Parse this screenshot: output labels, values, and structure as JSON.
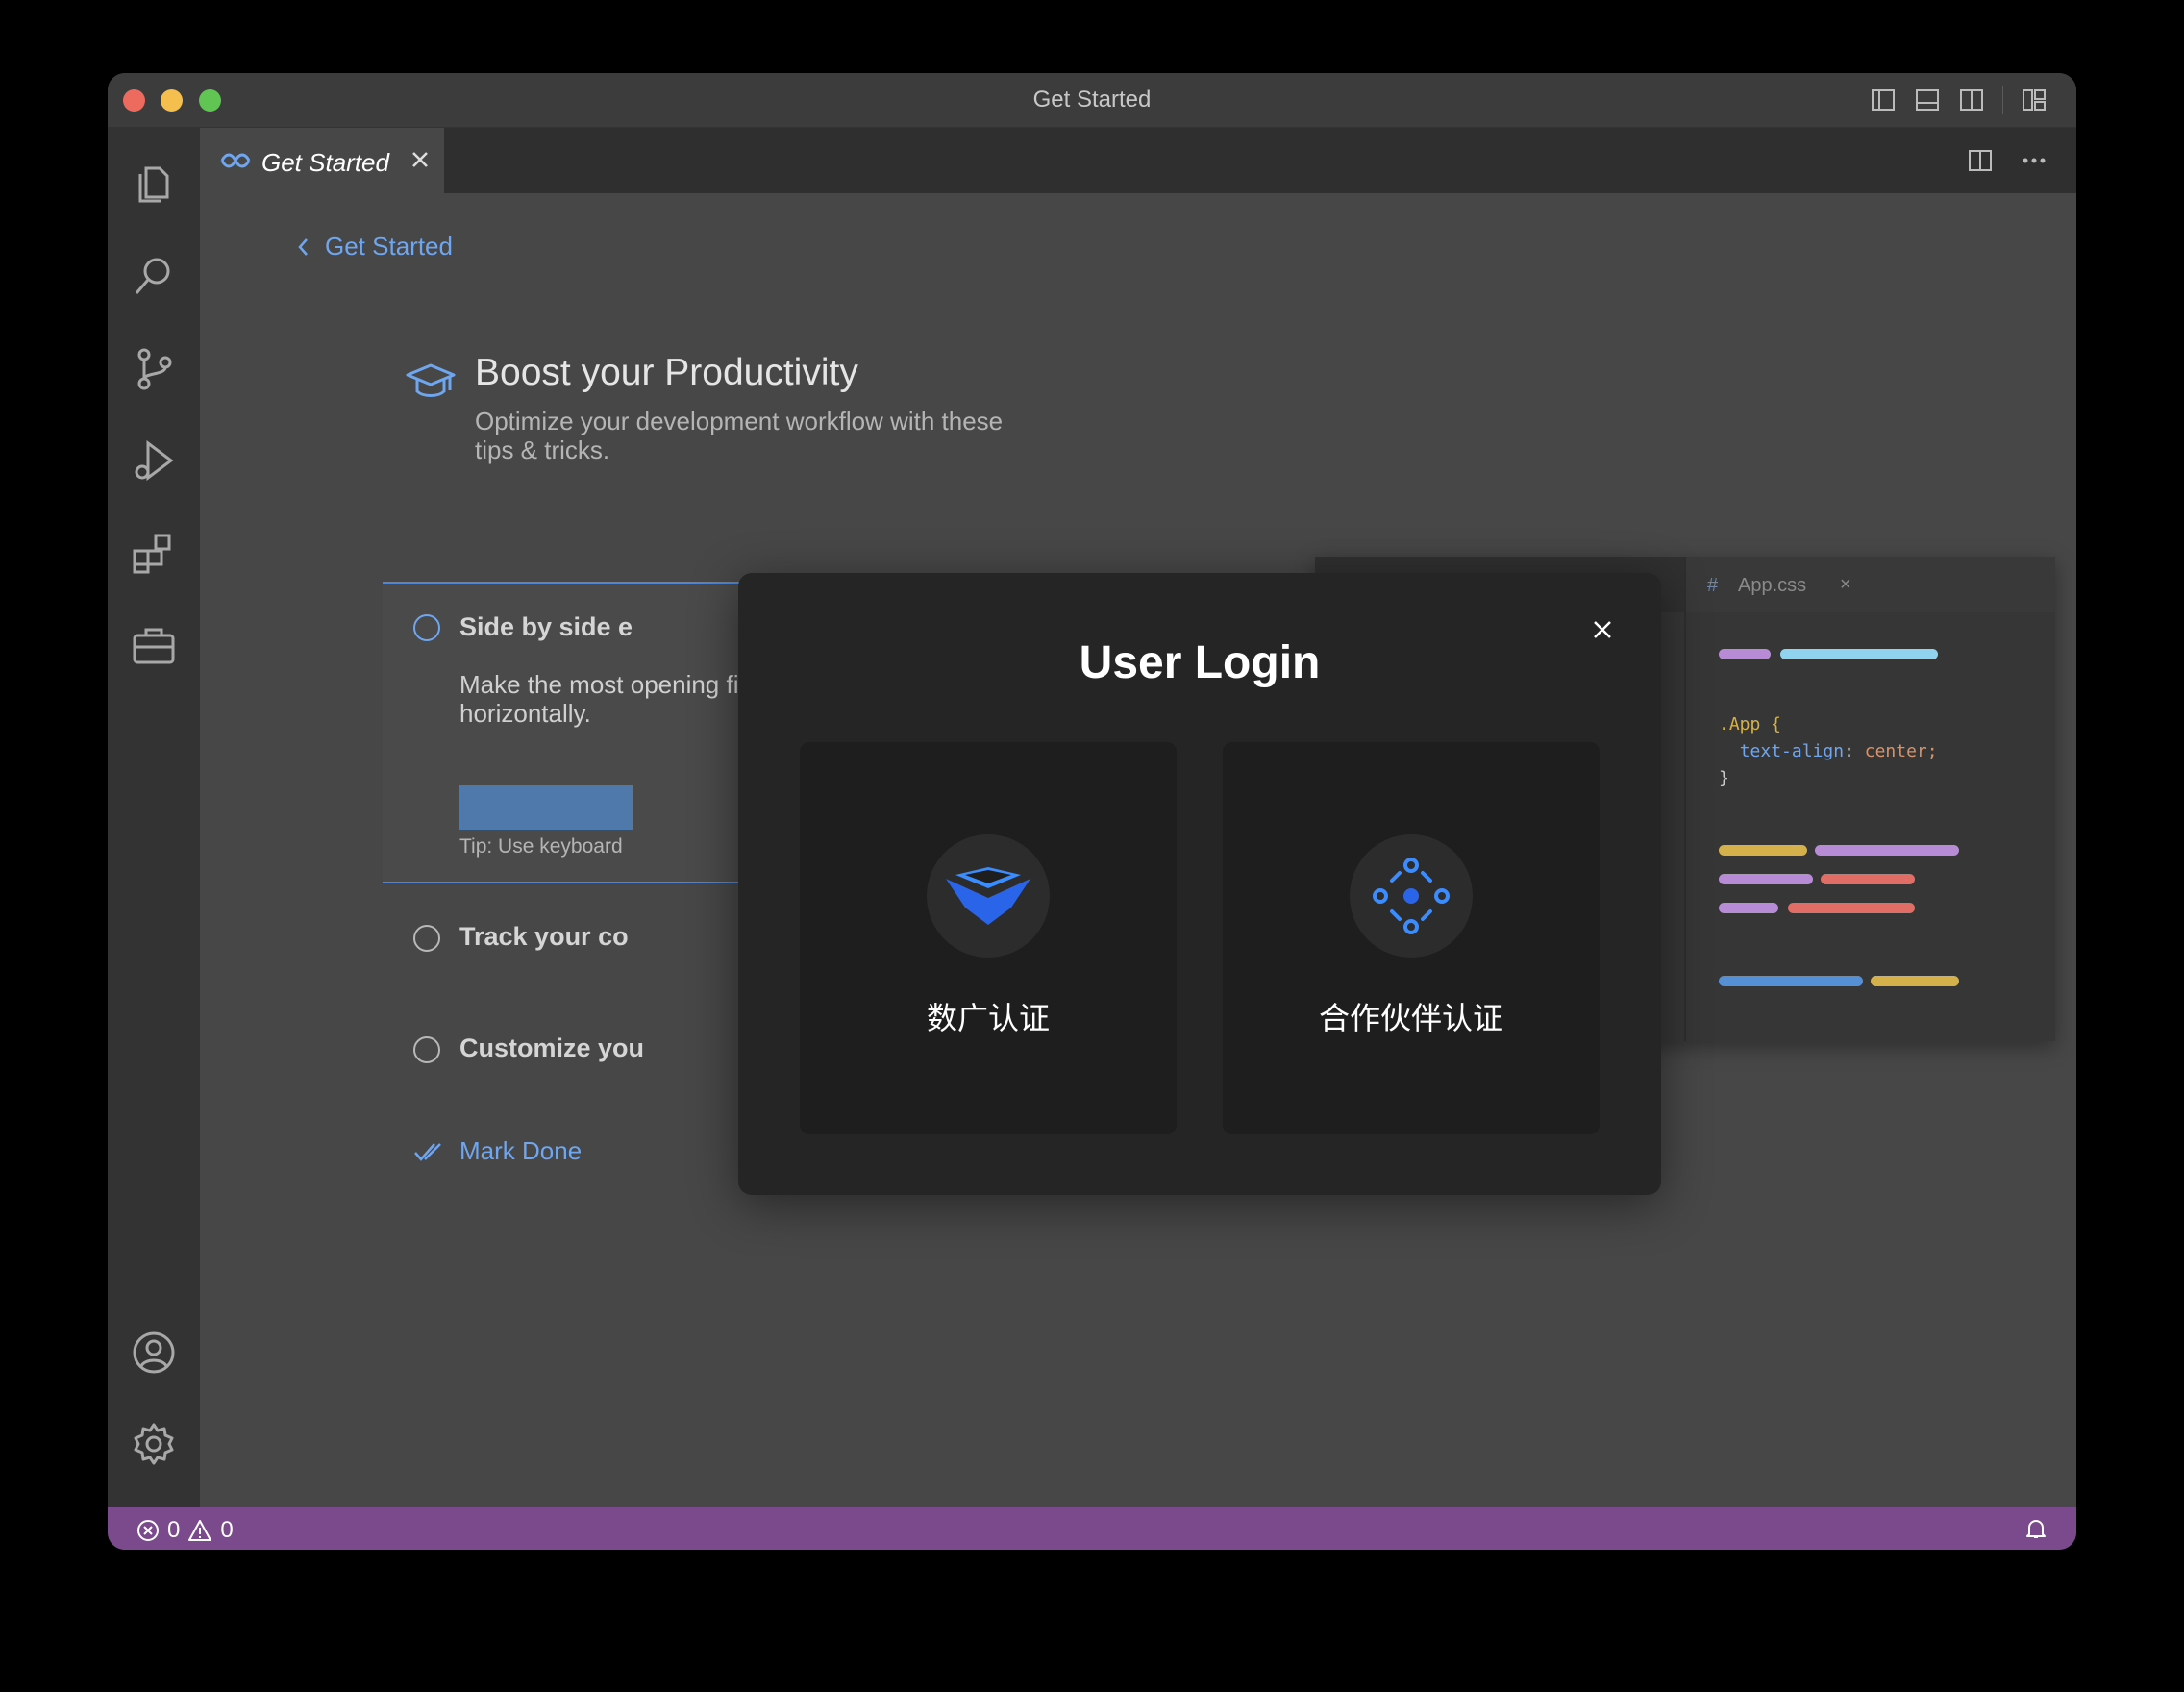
{
  "window": {
    "title": "Get Started"
  },
  "tab": {
    "label": "Get Started"
  },
  "breadcrumb": {
    "back_label": "Get Started"
  },
  "section": {
    "title": "Boost your Productivity",
    "subtitle": "Optimize your development workflow with these tips & tricks."
  },
  "steps": [
    {
      "title": "Side by side e",
      "description": "Make the most opening files si horizontally.",
      "tip": "Tip: Use keyboard"
    },
    {
      "title": "Track your co"
    },
    {
      "title": "Customize you"
    }
  ],
  "mark_done": "Mark Done",
  "preview": {
    "tab_hash": "#",
    "tab_label": "App.css",
    "tab_close": "×",
    "code_line1": ".App {",
    "code_line2_prop": "text-align",
    "code_line2_val": "center;",
    "code_line3": "}"
  },
  "modal": {
    "title": "User Login",
    "options": [
      {
        "label": "数广认证",
        "icon": "shield-chevron-icon"
      },
      {
        "label": "合作伙伴认证",
        "icon": "partner-network-icon"
      }
    ]
  },
  "status": {
    "errors": "0",
    "warnings": "0"
  },
  "colors": {
    "accent": "#6fa6f0",
    "statusbar": "#7a4a8c",
    "modal_bg": "#252526",
    "card_bg": "#1e1e1e"
  }
}
